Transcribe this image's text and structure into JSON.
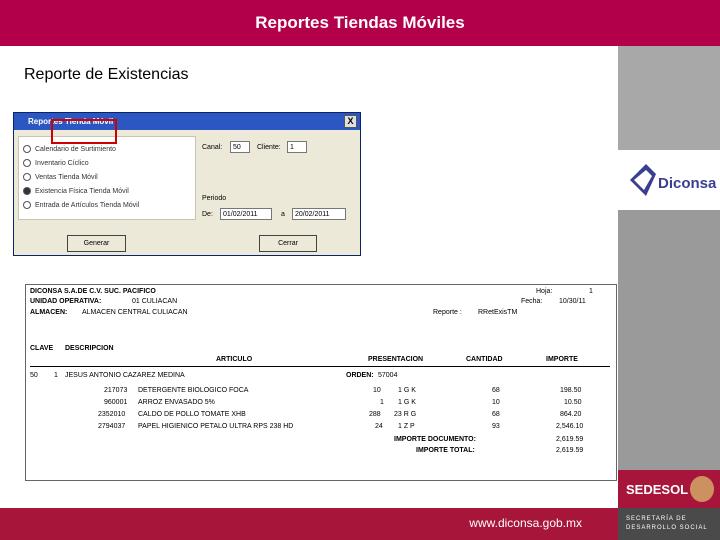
{
  "header": {
    "title": "Reportes Tiendas Móviles"
  },
  "page": {
    "heading": "Reporte de Existencias"
  },
  "brand": {
    "logo_text": "Diconsa",
    "sedesol_label": "SEDESOL",
    "secretaria_line1": "SECRETARÍA DE",
    "secretaria_line2": "DESARROLLO SOCIAL",
    "url": "www.diconsa.gob.mx",
    "accent": "#b3004a"
  },
  "dialog": {
    "title": "Reportes Tienda Móvil",
    "close": "X",
    "options": [
      "Calendario de Surtimiento",
      "Inventario Cíclico",
      "Ventas Tienda Móvil",
      "Existencia Física Tienda Móvil",
      "Entrada de Artículos Tienda Móvil"
    ],
    "selected_index": 3,
    "canal_label": "Canal:",
    "canal_value": "50",
    "cliente_label": "Cliente:",
    "cliente_value": "1",
    "periodo_label": "Periodo",
    "de_label": "De:",
    "from_date": "01/02/2011",
    "a_label": "a",
    "to_date": "20/02/2011",
    "generate_button": "Generar",
    "close_button": "Cerrar"
  },
  "report": {
    "company": "DICONSA S.A.DE C.V. SUC. PACIFICO",
    "unidad_label": "UNIDAD OPERATIVA:",
    "unidad_value": "01 CULIACAN",
    "almacen_label": "ALMACEN:",
    "almacen_value": "ALMACEN CENTRAL CULIACAN",
    "hoja_label": "Hoja:",
    "hoja_value": "1",
    "fecha_label": "Fecha:",
    "fecha_value": "10/30/11",
    "reporte_label": "Reporte :",
    "reporte_value": "RRetExisTM",
    "columns": {
      "clave": "CLAVE",
      "descripcion": "DESCRIPCION",
      "articulo": "ARTICULO",
      "presentacion": "PRESENTACION",
      "cantidad": "CANTIDAD",
      "importe": "IMPORTE"
    },
    "client_row": {
      "canal": "50",
      "cliente": "1",
      "nombre": "JESUS ANTONIO CAZAREZ MEDINA",
      "orden_label": "ORDEN:",
      "orden_value": "57004"
    },
    "rows": [
      {
        "codigo": "217073",
        "articulo": "DETERGENTE BIOLOGICO FOCA",
        "pres_num": "10",
        "pres_unit": "1 G K",
        "cantidad": "68",
        "importe": "198.50"
      },
      {
        "codigo": "960001",
        "articulo": "ARROZ ENVASADO 5%",
        "pres_num": "1",
        "pres_unit": "1 G K",
        "cantidad": "10",
        "importe": "10.50"
      },
      {
        "codigo": "2352010",
        "articulo": "CALDO DE POLLO TOMATE XHB",
        "pres_num": "288",
        "pres_unit": "23 R G",
        "cantidad": "68",
        "importe": "864.20"
      },
      {
        "codigo": "2794037",
        "articulo": "PAPEL HIGIENICO PETALO ULTRA RPS 238 HD",
        "pres_num": "24",
        "pres_unit": "1 Z P",
        "cantidad": "93",
        "importe": "2,546.10"
      }
    ],
    "importe_documento_label": "IMPORTE DOCUMENTO:",
    "importe_documento_value": "2,619.59",
    "importe_total_label": "IMPORTE TOTAL:",
    "importe_total_value": "2,619.59"
  }
}
